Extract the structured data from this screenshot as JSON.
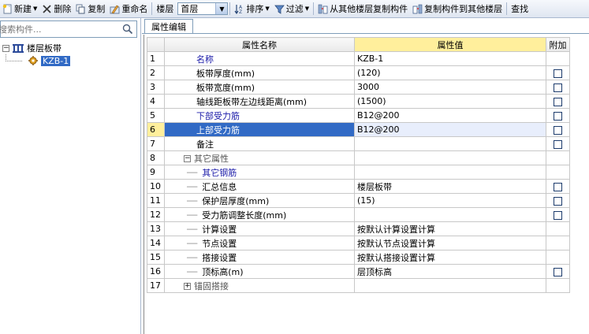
{
  "toolbar": {
    "new_label": "新建",
    "delete_label": "删除",
    "copy_label": "复制",
    "rename_label": "重命名",
    "floor_label": "楼层",
    "floor_value": "首层",
    "sort_label": "排序",
    "filter_label": "过滤",
    "copy_from_other_label": "从其他楼层复制构件",
    "copy_to_other_label": "复制构件到其他楼层",
    "query_label": "查找"
  },
  "search": {
    "placeholder": "搜索构件..."
  },
  "tree": {
    "root_label": "楼层板带",
    "child_label": "KZB-1"
  },
  "tab": {
    "label": "属性编辑"
  },
  "grid": {
    "headers": {
      "name": "属性名称",
      "value": "属性值",
      "extra": "附加"
    },
    "rows": [
      {
        "num": "1",
        "name": "名称",
        "value": "KZB-1",
        "style": "blue",
        "check": false
      },
      {
        "num": "2",
        "name": "板带厚度(mm)",
        "value": "(120)",
        "style": "normal",
        "check": true
      },
      {
        "num": "3",
        "name": "板带宽度(mm)",
        "value": "3000",
        "style": "normal",
        "check": true
      },
      {
        "num": "4",
        "name": "轴线距板带左边线距离(mm)",
        "value": "(1500)",
        "style": "normal",
        "check": true
      },
      {
        "num": "5",
        "name": "下部受力筋",
        "value": "B12@200",
        "style": "blue",
        "check": true
      },
      {
        "num": "6",
        "name": "上部受力筋",
        "value": "B12@200",
        "style": "selected",
        "check": true
      },
      {
        "num": "7",
        "name": "备注",
        "value": "",
        "style": "normal",
        "check": true
      },
      {
        "num": "8",
        "name": "其它属性",
        "value": "",
        "style": "group-open",
        "check": false
      },
      {
        "num": "9",
        "name": "其它钢筋",
        "value": "",
        "style": "sub-blue",
        "check": false
      },
      {
        "num": "10",
        "name": "汇总信息",
        "value": "楼层板带",
        "style": "sub",
        "check": true
      },
      {
        "num": "11",
        "name": "保护层厚度(mm)",
        "value": "(15)",
        "style": "sub",
        "check": true
      },
      {
        "num": "12",
        "name": "受力筋调整长度(mm)",
        "value": "",
        "style": "sub",
        "check": true
      },
      {
        "num": "13",
        "name": "计算设置",
        "value": "按默认计算设置计算",
        "style": "sub",
        "check": false
      },
      {
        "num": "14",
        "name": "节点设置",
        "value": "按默认节点设置计算",
        "style": "sub",
        "check": false
      },
      {
        "num": "15",
        "name": "搭接设置",
        "value": "按默认搭接设置计算",
        "style": "sub",
        "check": false
      },
      {
        "num": "16",
        "name": "顶标高(m)",
        "value": "层顶标高",
        "style": "sub",
        "check": true
      },
      {
        "num": "17",
        "name": "锚固搭接",
        "value": "",
        "style": "group-closed",
        "check": false
      }
    ]
  }
}
